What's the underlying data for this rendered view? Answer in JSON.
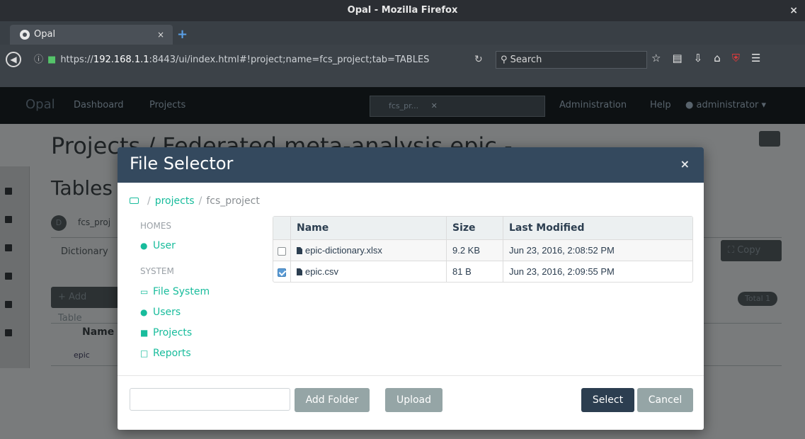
{
  "window": {
    "title": "Opal - Mozilla Firefox",
    "close_glyph": "×"
  },
  "browser": {
    "tab_title": "Opal",
    "tab_close": "×",
    "new_tab": "+",
    "url_prefix": "https://",
    "url_host": "192.168.1.1",
    "url_rest": ":8443/ui/index.html#!project;name=fcs_project;tab=TABLES",
    "search_placeholder": "Search",
    "icons": [
      "star-icon",
      "reading-list-icon",
      "download-icon",
      "home-icon",
      "ublock-icon",
      "menu-icon"
    ]
  },
  "app": {
    "brand": "Opal",
    "nav": {
      "dashboard": "Dashboard",
      "projects": "Projects",
      "administration": "Administration",
      "help": "Help",
      "user": "administrator"
    },
    "search_chip": "fcs_pr..."
  },
  "background": {
    "heading": "Projects / Federated meta-analysis epic -",
    "tables_title": "Tables",
    "project_badge": "D",
    "project_name": "fcs_proj",
    "dictionary_tab": "Dictionary",
    "add_table_button": "Add Table",
    "copy_button": "Copy",
    "total_badge": "Total 1",
    "name_header": "Name",
    "row_name": "epic"
  },
  "modal": {
    "title": "File Selector",
    "close": "×",
    "breadcrumb": {
      "root": "projects",
      "current": "fcs_project",
      "separator": "/"
    },
    "sections": {
      "homes": "HOMES",
      "system": "SYSTEM"
    },
    "homes_items": [
      {
        "label": "User",
        "icon": "user-icon"
      }
    ],
    "system_items": [
      {
        "label": "File System",
        "icon": "hdd-icon"
      },
      {
        "label": "Users",
        "icon": "users-icon"
      },
      {
        "label": "Projects",
        "icon": "briefcase-icon"
      },
      {
        "label": "Reports",
        "icon": "file-icon"
      }
    ],
    "table": {
      "columns": [
        "Name",
        "Size",
        "Last Modified"
      ],
      "rows": [
        {
          "name": "epic-dictionary.xlsx",
          "size": "9.2 KB",
          "modified": "Jun 23, 2016, 2:08:52 PM",
          "checked": false
        },
        {
          "name": "epic.csv",
          "size": "81 B",
          "modified": "Jun 23, 2016, 2:09:55 PM",
          "checked": true
        }
      ]
    },
    "footer": {
      "folder_input_value": "",
      "add_folder": "Add Folder",
      "upload": "Upload",
      "select": "Select",
      "cancel": "Cancel"
    }
  },
  "colors": {
    "accent": "#18bc9c",
    "header": "#34495e",
    "primary": "#2c3e50",
    "secondary": "#95a5a6"
  }
}
